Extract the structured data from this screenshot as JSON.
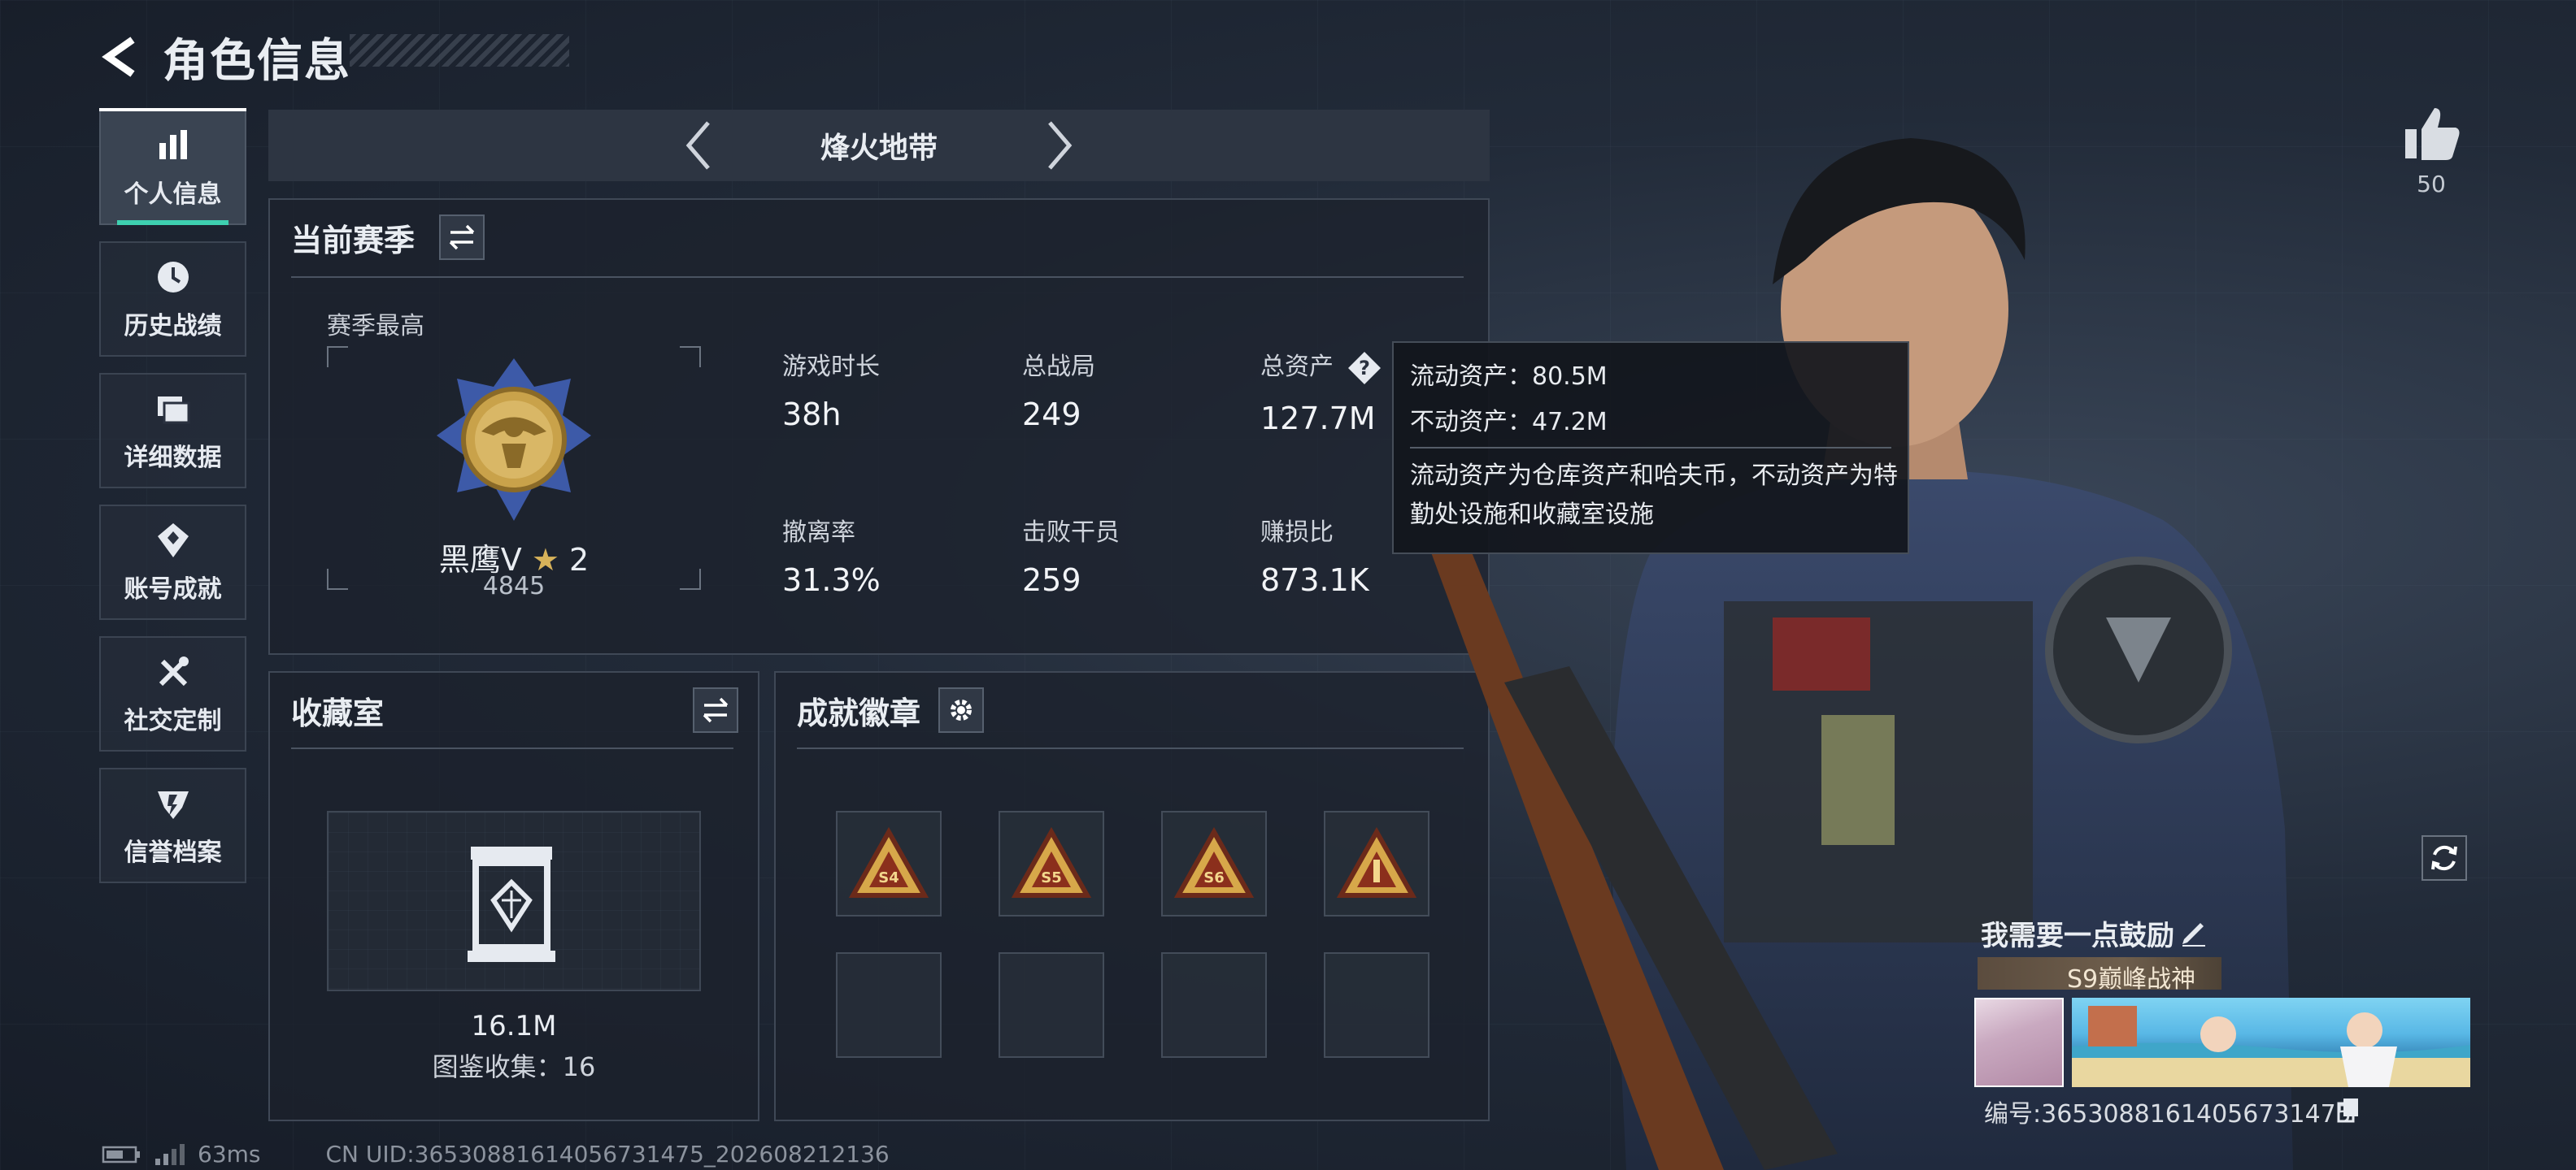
{
  "header": {
    "title": "角色信息"
  },
  "sidebar": {
    "items": [
      {
        "label": "个人信息",
        "icon": "bar-chart-icon",
        "active": true
      },
      {
        "label": "历史战绩",
        "icon": "clock-icon"
      },
      {
        "label": "详细数据",
        "icon": "folder-icon"
      },
      {
        "label": "账号成就",
        "icon": "achievement-icon"
      },
      {
        "label": "社交定制",
        "icon": "tools-icon"
      },
      {
        "label": "信誉档案",
        "icon": "reputation-icon"
      }
    ]
  },
  "mode": {
    "name": "烽火地带"
  },
  "season": {
    "title": "当前赛季",
    "best_label": "赛季最高",
    "rank_name": "黑鹰Ⅴ",
    "rank_stars": "2",
    "rank_score": "4845",
    "stats": [
      {
        "label": "游戏时长",
        "value": "38h"
      },
      {
        "label": "总战局",
        "value": "249"
      },
      {
        "label": "总资产",
        "value": "127.7M"
      },
      {
        "label": "撤离率",
        "value": "31.3%"
      },
      {
        "label": "击败干员",
        "value": "259"
      },
      {
        "label": "赚损比",
        "value": "873.1K"
      }
    ]
  },
  "tooltip": {
    "liquid": "流动资产：80.5M",
    "fixed": "不动资产：47.2M",
    "description": "流动资产为仓库资产和哈夫币，不动资产为特勤处设施和收藏室设施"
  },
  "collection": {
    "title": "收藏室",
    "value": "16.1M",
    "count_text": "图鉴收集：16"
  },
  "achievements": {
    "title": "成就徽章",
    "badges": [
      {
        "label": "S4",
        "filled": true
      },
      {
        "label": "S5",
        "filled": true
      },
      {
        "label": "S6",
        "filled": true
      },
      {
        "label": "",
        "filled": true
      },
      {
        "label": "",
        "filled": false
      },
      {
        "label": "",
        "filled": false
      },
      {
        "label": "",
        "filled": false
      },
      {
        "label": "",
        "filled": false
      }
    ]
  },
  "likes": {
    "count": "50"
  },
  "profile": {
    "slogan": "我需要一点鼓励",
    "title_badge": "S9巅峰战神",
    "player_id": "编号:3653088161405673147​5"
  },
  "footer": {
    "ping": "63ms",
    "uid": "CN UID:36530881614056731475_202608212136"
  },
  "colors": {
    "accent": "#3ed0b0",
    "gold": "#c9a24a",
    "panel_border": "#3f4856"
  }
}
